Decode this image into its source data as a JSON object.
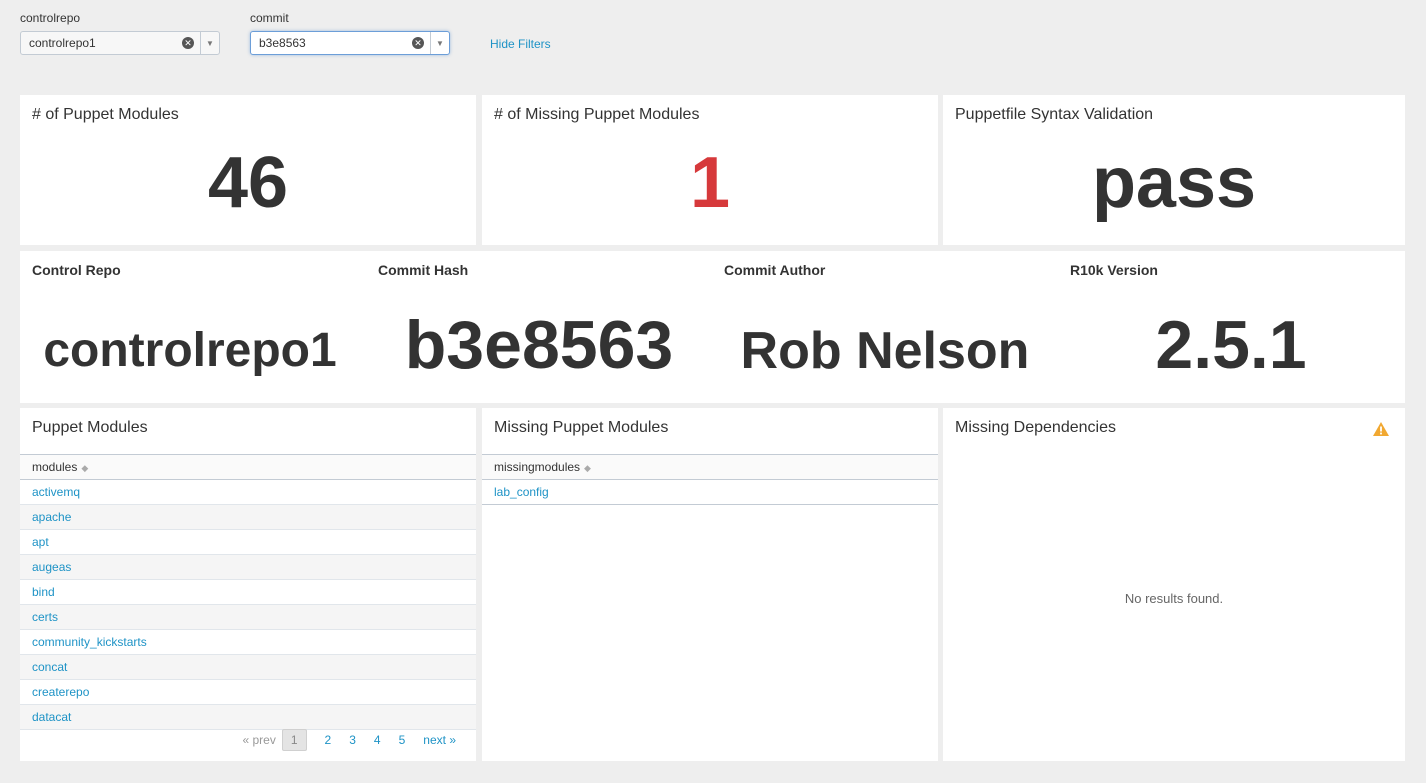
{
  "filters": {
    "controlrepo": {
      "label": "controlrepo",
      "value": "controlrepo1"
    },
    "commit": {
      "label": "commit",
      "value": "b3e8563"
    },
    "hide_filters": "Hide Filters"
  },
  "kpis": [
    {
      "title": "# of Puppet Modules",
      "value": "46",
      "color": "#333333"
    },
    {
      "title": "# of Missing Puppet Modules",
      "value": "1",
      "color": "#d6393b"
    },
    {
      "title": "Puppetfile Syntax Validation",
      "value": "pass",
      "color": "#333333"
    }
  ],
  "summary": [
    {
      "title": "Control Repo",
      "value": "controlrepo1"
    },
    {
      "title": "Commit Hash",
      "value": "b3e8563"
    },
    {
      "title": "Commit Author",
      "value": "Rob Nelson"
    },
    {
      "title": "R10k Version",
      "value": "2.5.1"
    }
  ],
  "puppet_modules": {
    "title": "Puppet Modules",
    "column": "modules",
    "rows": [
      "activemq",
      "apache",
      "apt",
      "augeas",
      "bind",
      "certs",
      "community_kickstarts",
      "concat",
      "createrepo",
      "datacat"
    ],
    "pager": {
      "prev": "« prev",
      "pages": [
        "1",
        "2",
        "3",
        "4",
        "5"
      ],
      "current": "1",
      "next": "next »"
    }
  },
  "missing_modules": {
    "title": "Missing Puppet Modules",
    "column": "missingmodules",
    "rows": [
      "lab_config"
    ]
  },
  "missing_dependencies": {
    "title": "Missing Dependencies",
    "empty_text": "No results found.",
    "warning_icon": "warning-icon"
  }
}
